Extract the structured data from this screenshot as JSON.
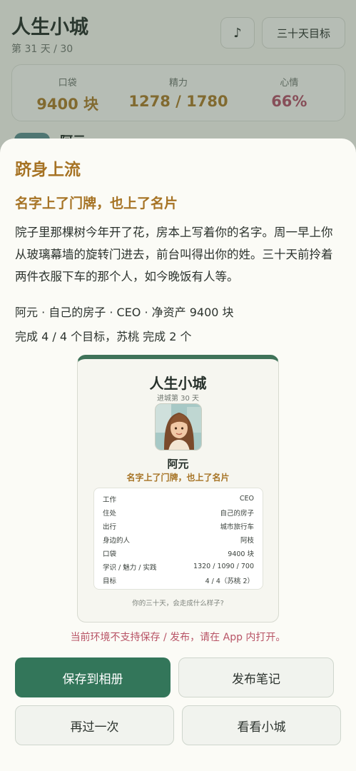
{
  "header": {
    "title": "人生小城",
    "subtitle": "第 31 天 / 30",
    "music_icon": "♪",
    "goal_button": "三十天目标"
  },
  "stats": [
    {
      "label": "口袋",
      "value": "9400 块"
    },
    {
      "label": "精力",
      "value": "1278 / 1780"
    },
    {
      "label": "心情",
      "value": "66%"
    }
  ],
  "background_character": {
    "name": "阿元"
  },
  "sheet": {
    "title": "跻身上流",
    "subtitle": "名字上了门牌，也上了名片",
    "story": "院子里那棵树今年开了花，房本上写着你的名字。周一早上你从玻璃幕墙的旋转门进去，前台叫得出你的姓。三十天前拎着两件衣服下车的那个人，如今晚饭有人等。",
    "meta_line1": "阿元 · 自己的房子 · CEO · 净资产 9400 块",
    "meta_line2": "完成 4 / 4 个目标，苏桃 完成 2 个",
    "warning": "当前环境不支持保存 / 发布，请在 App 内打开。",
    "buttons": {
      "save": "保存到相册",
      "publish": "发布笔记",
      "retry": "再过一次",
      "town": "看看小城"
    }
  },
  "card": {
    "title": "人生小城",
    "day": "进城第 30 天",
    "name": "阿元",
    "tagline": "名字上了门牌，也上了名片",
    "rows": [
      {
        "label": "工作",
        "value": "CEO"
      },
      {
        "label": "住处",
        "value": "自己的房子"
      },
      {
        "label": "出行",
        "value": "城市旅行车"
      },
      {
        "label": "身边的人",
        "value": "阿枝"
      },
      {
        "label": "口袋",
        "value": "9400 块"
      },
      {
        "label": "学识 / 魅力 / 实践",
        "value": "1320 / 1090 / 700"
      },
      {
        "label": "目标",
        "value": "4 / 4（苏桃 2）"
      }
    ],
    "footer": "你的三十天，会走成什么样子?"
  },
  "colors": {
    "accent_green": "#33765a",
    "gold": "#a67324",
    "mood_pink": "#b05369",
    "warning": "#b85466"
  }
}
